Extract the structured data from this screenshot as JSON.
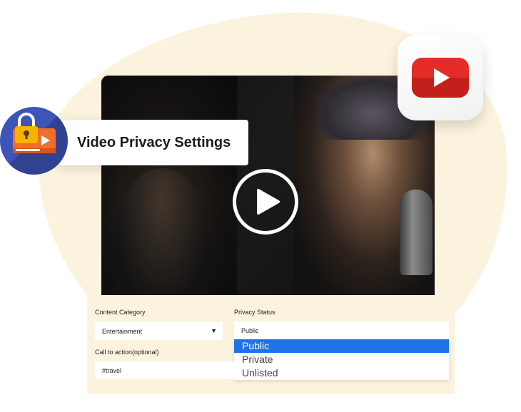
{
  "hero": {
    "title": "Video Privacy Settings"
  },
  "icons": {
    "badge": "lock-video-icon",
    "youtube": "youtube-logo-icon",
    "play": "play-icon"
  },
  "colors": {
    "blob": "#fcf3de",
    "badge": "#3d54b8",
    "youtube_red": "#e52d27",
    "selected": "#1e73e8"
  },
  "form": {
    "content_category": {
      "label": "Content Category",
      "value": "Entertainment"
    },
    "privacy_status": {
      "label": "Privacy Status",
      "value": "Public",
      "options": [
        "Public",
        "Private",
        "Unlisted"
      ],
      "selected": "Public"
    },
    "call_to_action": {
      "label": "Call to action(optional)",
      "value": "#travel"
    }
  }
}
